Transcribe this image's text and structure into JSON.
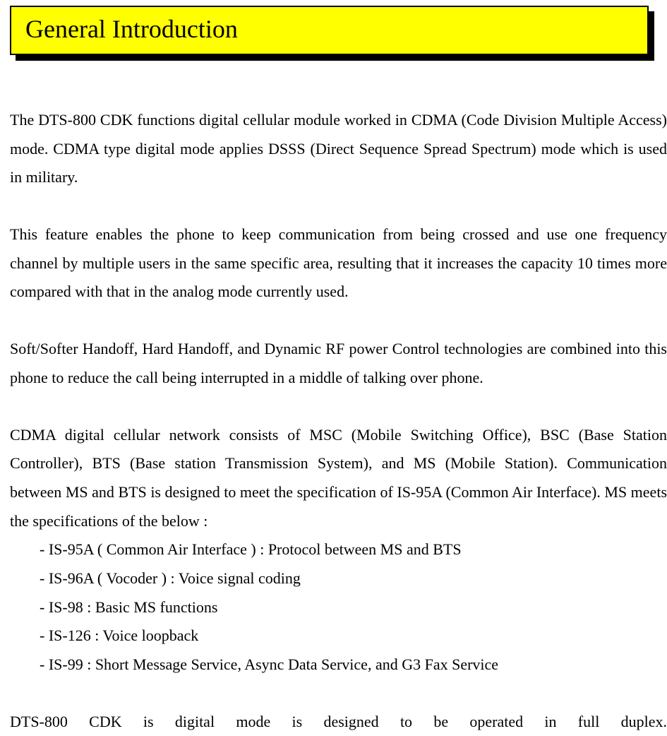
{
  "header": {
    "title": "General Introduction"
  },
  "content": {
    "para1": "The DTS-800 CDK functions digital cellular module worked in CDMA (Code Division Multiple Access) mode. CDMA type digital mode applies DSSS (Direct Sequence Spread Spectrum) mode which is used in military.",
    "para2": "This feature enables the phone to keep communication from being crossed and use one frequency channel by multiple users in the same specific area, resulting that it increases the capacity 10 times more compared with that in the analog mode currently used.",
    "para3": "Soft/Softer Handoff, Hard Handoff, and Dynamic RF power Control technologies are combined into this phone to reduce the call being interrupted in a middle of talking over phone.",
    "para4": "CDMA digital cellular network consists of MSC (Mobile Switching Office), BSC (Base Station Controller), BTS (Base station Transmission System), and MS (Mobile Station). Communication between MS and BTS is designed to meet the specification of IS-95A (Common Air Interface). MS meets the specifications of the below :",
    "specs": [
      "- IS-95A ( Common Air Interface ) : Protocol between MS and BTS",
      "- IS-96A ( Vocoder ) : Voice signal coding",
      "- IS-98 : Basic MS functions",
      "- IS-126 : Voice loopback",
      "- IS-99 : Short Message Service, Async Data Service, and G3 Fax Service"
    ],
    "para5": "DTS-800 CDK is digital mode is designed to be operated in full duplex."
  }
}
